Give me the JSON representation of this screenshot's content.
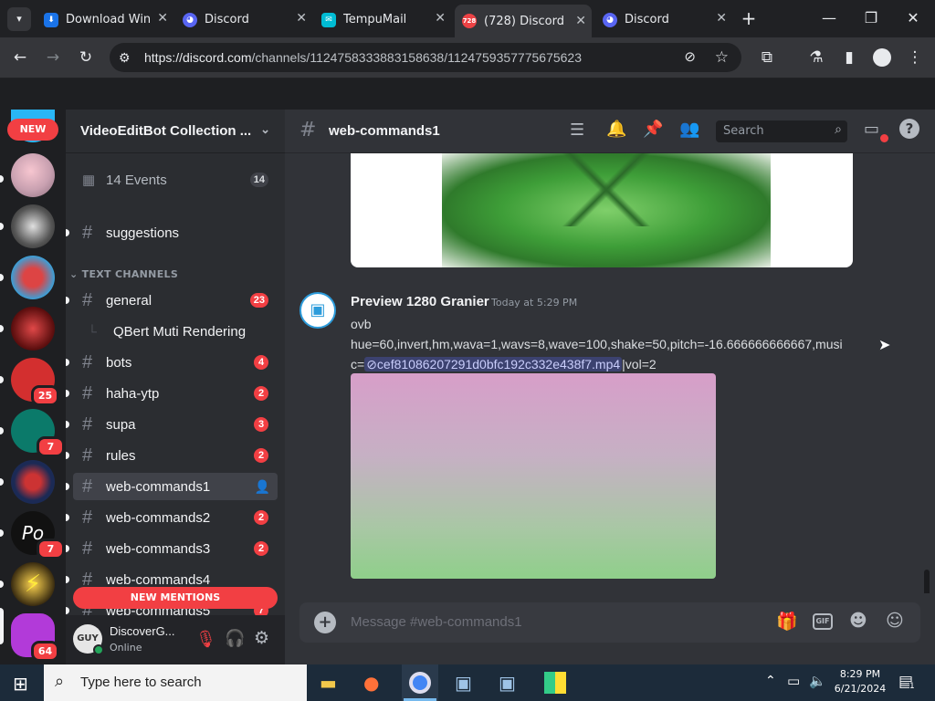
{
  "browser": {
    "tabs": [
      {
        "title": "Download Win",
        "favicon": "download-icon",
        "color": "#1a73e8"
      },
      {
        "title": "Discord",
        "favicon": "discord-icon",
        "color": "#5865f2"
      },
      {
        "title": "TempuMail",
        "favicon": "tempumail-icon",
        "color": "#00bcd4"
      },
      {
        "title": "(728) Discord |",
        "favicon": "discord-icon",
        "color": "#ed4245",
        "badge": "728",
        "active": true
      },
      {
        "title": "Discord",
        "favicon": "discord-icon",
        "color": "#5865f2"
      }
    ],
    "url_host": "https://discord.com",
    "url_path": "/channels/1124758333883158638/1124759357775675623"
  },
  "servers": {
    "new_label": "NEW",
    "badges": [
      "25",
      "7",
      "7",
      "64"
    ]
  },
  "sidebar": {
    "guild_name": "VideoEditBot Collection ...",
    "events_label": "14 Events",
    "events_count": "14",
    "suggestions": "suggestions",
    "section_label": "TEXT CHANNELS",
    "channels": [
      {
        "name": "general",
        "badge": "23"
      },
      {
        "name": "QBert Muti Rendering",
        "thread": true
      },
      {
        "name": "bots",
        "badge": "4"
      },
      {
        "name": "haha-ytp",
        "badge": "2"
      },
      {
        "name": "supa",
        "badge": "3"
      },
      {
        "name": "rules",
        "badge": "2"
      },
      {
        "name": "web-commands1",
        "selected": true
      },
      {
        "name": "web-commands2",
        "badge": "2"
      },
      {
        "name": "web-commands3",
        "badge": "2"
      },
      {
        "name": "web-commands4"
      },
      {
        "name": "web-commands5",
        "badge": "7"
      }
    ],
    "new_mentions": "NEW MENTIONS",
    "user_name": "DiscoverG...",
    "user_status": "Online"
  },
  "chat": {
    "channel": "web-commands1",
    "search_placeholder": "Search",
    "message": {
      "author": "Preview 1280 Granier",
      "timestamp": "Today at 5:29 PM",
      "line1": "ovb",
      "line2": "hue=60,invert,hm,wava=1,wavs=8,wave=100,shake=50,pitch=-16.666666666667,musi",
      "line3_prefix": "c=",
      "mention": "cef81086207291d0bfc192c332e438f7.mp4",
      "line3_suffix": "|vol=2"
    },
    "composer_placeholder": "Message #web-commands1",
    "gif_label": "GIF"
  },
  "taskbar": {
    "search_placeholder": "Type here to search",
    "time": "8:29 PM",
    "date": "6/21/2024",
    "notification_count": "1"
  },
  "colors": {
    "accent": "#5865f2",
    "mention_bg": "#3c4270",
    "badge_red": "#f23f43"
  }
}
